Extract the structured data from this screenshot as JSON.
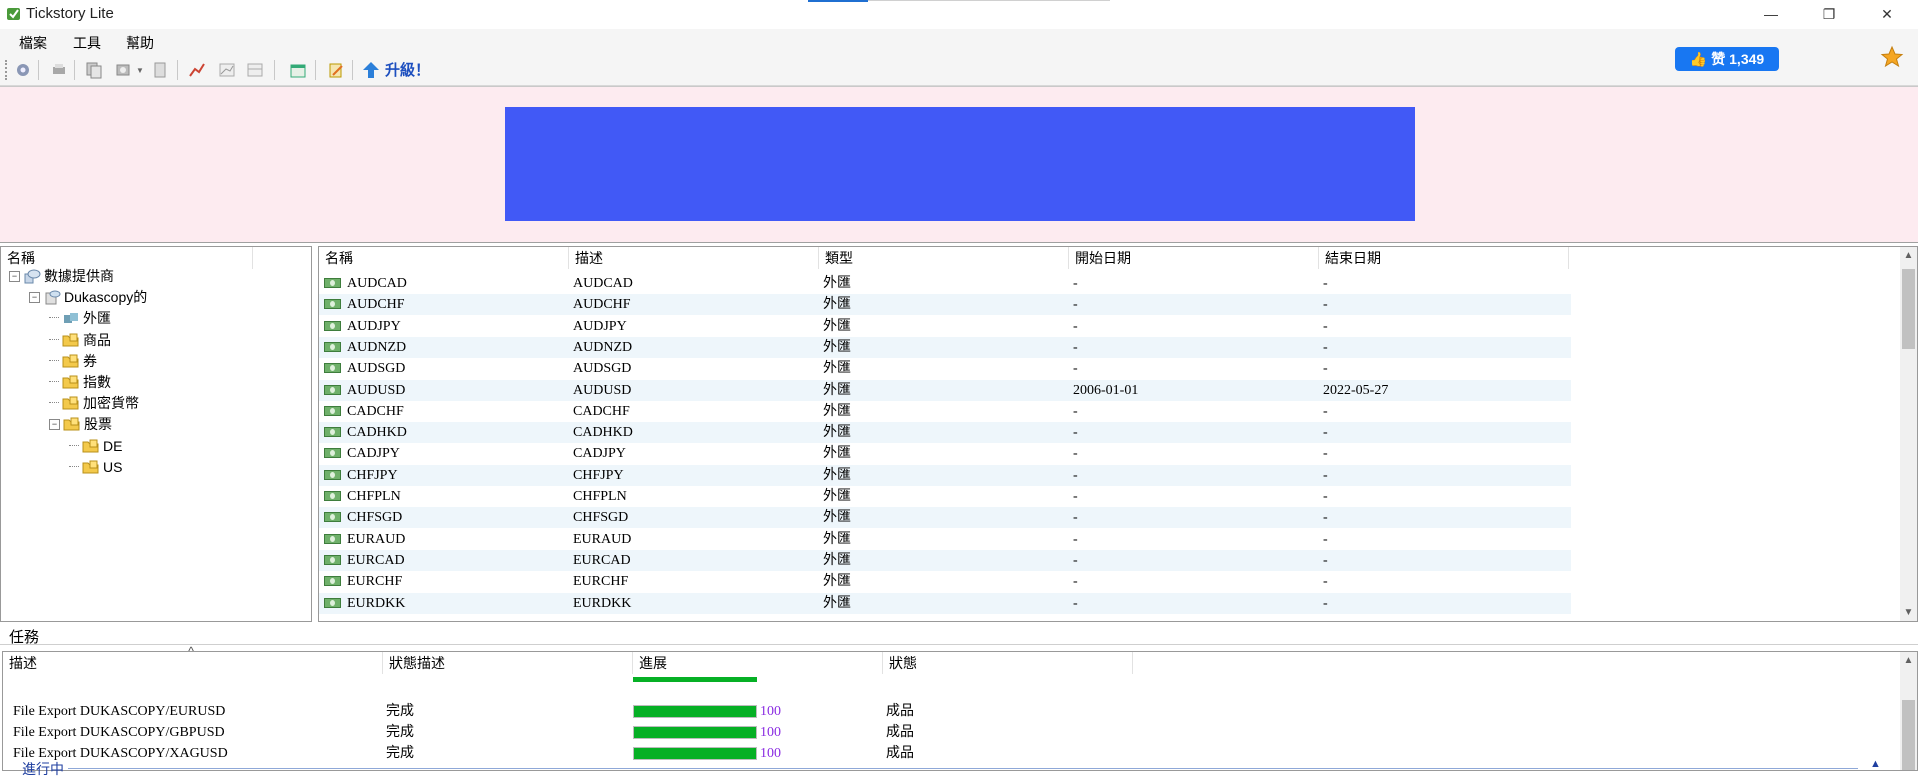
{
  "window": {
    "title": "Tickstory Lite",
    "min_glyph": "—",
    "max_glyph": "❐",
    "close_glyph": "✕"
  },
  "menu": [
    "檔案",
    "工具",
    "幫助"
  ],
  "toolbar": {
    "upgrade_label": "升級！"
  },
  "social": {
    "like_label": "赞 1,349"
  },
  "tree": {
    "header": "名稱",
    "items": [
      {
        "label": "數據提供商",
        "level": 0,
        "expander": "−"
      },
      {
        "label": "Dukascopy的",
        "level": 1,
        "expander": "−"
      },
      {
        "label": "外匯",
        "level": 2,
        "expander": ""
      },
      {
        "label": "商品",
        "level": 2,
        "expander": ""
      },
      {
        "label": "券",
        "level": 2,
        "expander": ""
      },
      {
        "label": "指數",
        "level": 2,
        "expander": ""
      },
      {
        "label": "加密貨幣",
        "level": 2,
        "expander": ""
      },
      {
        "label": "股票",
        "level": 2,
        "expander": "−"
      },
      {
        "label": "DE",
        "level": 3,
        "expander": ""
      },
      {
        "label": "US",
        "level": 3,
        "expander": ""
      }
    ]
  },
  "grid": {
    "columns": [
      "名稱",
      "描述",
      "類型",
      "開始日期",
      "結束日期"
    ],
    "rows": [
      [
        "AUDCAD",
        "AUDCAD",
        "外匯",
        "-",
        "-"
      ],
      [
        "AUDCHF",
        "AUDCHF",
        "外匯",
        "-",
        "-"
      ],
      [
        "AUDJPY",
        "AUDJPY",
        "外匯",
        "-",
        "-"
      ],
      [
        "AUDNZD",
        "AUDNZD",
        "外匯",
        "-",
        "-"
      ],
      [
        "AUDSGD",
        "AUDSGD",
        "外匯",
        "-",
        "-"
      ],
      [
        "AUDUSD",
        "AUDUSD",
        "外匯",
        "2006-01-01",
        "2022-05-27"
      ],
      [
        "CADCHF",
        "CADCHF",
        "外匯",
        "-",
        "-"
      ],
      [
        "CADHKD",
        "CADHKD",
        "外匯",
        "-",
        "-"
      ],
      [
        "CADJPY",
        "CADJPY",
        "外匯",
        "-",
        "-"
      ],
      [
        "CHFJPY",
        "CHFJPY",
        "外匯",
        "-",
        "-"
      ],
      [
        "CHFPLN",
        "CHFPLN",
        "外匯",
        "-",
        "-"
      ],
      [
        "CHFSGD",
        "CHFSGD",
        "外匯",
        "-",
        "-"
      ],
      [
        "EURAUD",
        "EURAUD",
        "外匯",
        "-",
        "-"
      ],
      [
        "EURCAD",
        "EURCAD",
        "外匯",
        "-",
        "-"
      ],
      [
        "EURCHF",
        "EURCHF",
        "外匯",
        "-",
        "-"
      ],
      [
        "EURDKK",
        "EURDKK",
        "外匯",
        "-",
        "-"
      ]
    ]
  },
  "tasks": {
    "section_label": "任務",
    "sort_glyph": "^",
    "columns": [
      "描述",
      "狀態描述",
      "進展",
      "狀態"
    ],
    "rows": [
      {
        "desc": "File Export DUKASCOPY/EURUSD",
        "status_desc": "完成",
        "progress": 100,
        "progress_label": "100",
        "status": "成品"
      },
      {
        "desc": "File Export DUKASCOPY/GBPUSD",
        "status_desc": "完成",
        "progress": 100,
        "progress_label": "100",
        "status": "成品"
      },
      {
        "desc": "File Export DUKASCOPY/XAGUSD",
        "status_desc": "完成",
        "progress": 100,
        "progress_label": "100",
        "status": "成品"
      }
    ],
    "running_label": "進行中"
  },
  "colors": {
    "accent": "#1877f2",
    "banner_bg": "#fdebf0",
    "ad": "#4159f6",
    "progress": "#06b025",
    "alt_row": "#eef6fb"
  }
}
